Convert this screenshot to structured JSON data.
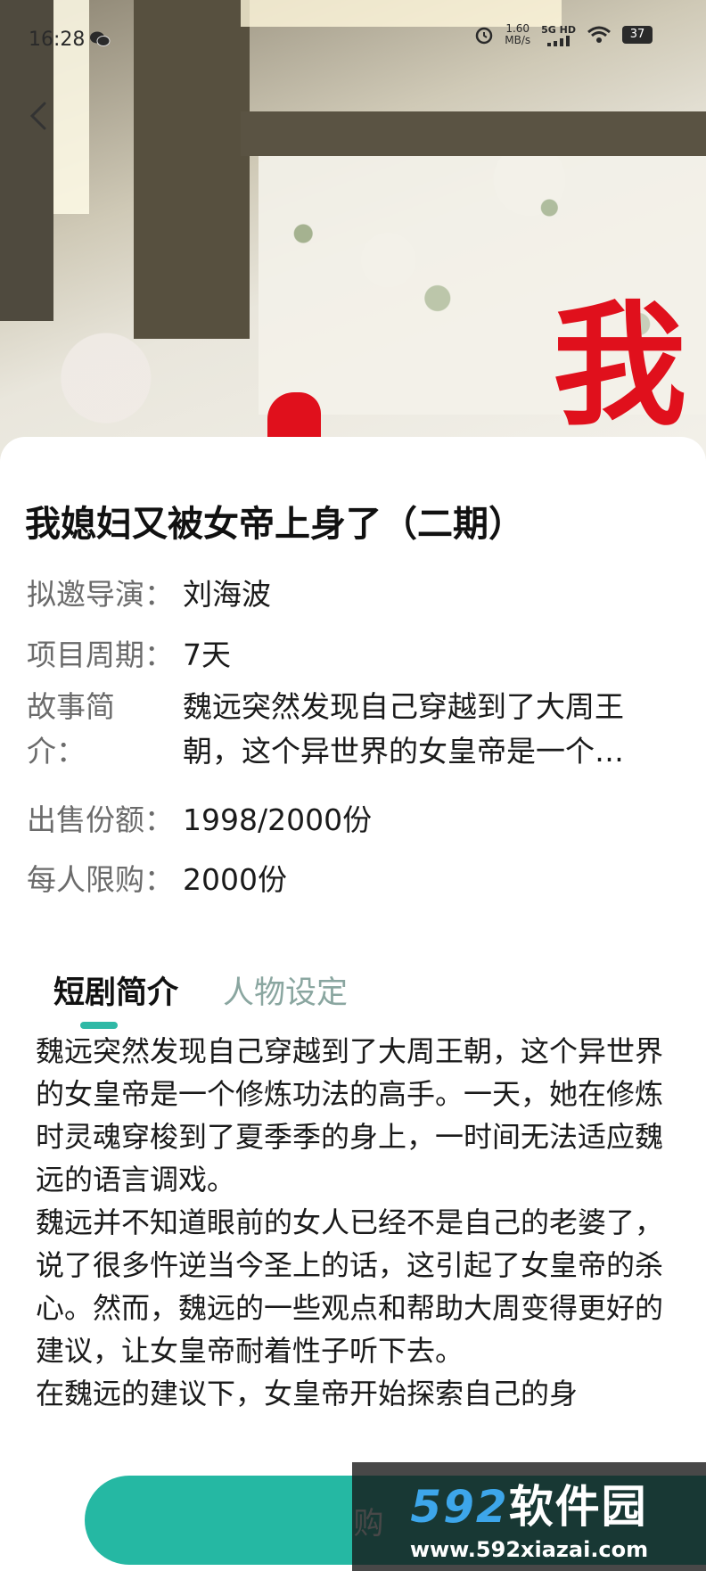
{
  "status_bar": {
    "time": "16:28",
    "network_speed": "1.60",
    "network_unit": "MB/s",
    "signal_label": "5G HD",
    "battery": "37"
  },
  "project": {
    "title": "我媳妇又被女帝上身了（二期）",
    "fields": [
      {
        "label": "拟邀导演：",
        "value": "刘海波"
      },
      {
        "label": "项目周期：",
        "value": "7天"
      },
      {
        "label": "故事简介：",
        "value": "魏远突然发现自己穿越到了大周王朝，这个异世界的女皇帝是一个…"
      },
      {
        "label": "出售份额：",
        "value": "1998/2000份"
      },
      {
        "label": "每人限购：",
        "value": "2000份"
      }
    ]
  },
  "tabs": [
    {
      "label": "短剧简介",
      "active": true
    },
    {
      "label": "人物设定",
      "active": false
    }
  ],
  "description": [
    "魏远突然发现自己穿越到了大周王朝，这个异世界的女皇帝是一个修炼功法的高手。一天，她在修炼时灵魂穿梭到了夏季季的身上，一时间无法适应魏远的语言调戏。",
    "魏远并不知道眼前的女人已经不是自己的老婆了，说了很多忤逆当今圣上的话，这引起了女皇帝的杀心。然而，魏远的一些观点和帮助大周变得更好的建议，让女皇帝耐着性子听下去。",
    "在魏远的建议下，女皇帝开始探索自己的身"
  ],
  "buy_button": {
    "label": "购"
  },
  "watermark": {
    "brand_digits": "592",
    "brand_text": "软件园",
    "url": "www.592xiazai.com"
  },
  "colors": {
    "accent": "#25b8a3",
    "tab_indicator": "#2fb9a6",
    "label_gray": "#6b6b6b"
  },
  "icons": [
    "back-icon",
    "wechat-icon",
    "alarm-icon",
    "signal-icon",
    "wifi-icon",
    "battery-icon"
  ]
}
